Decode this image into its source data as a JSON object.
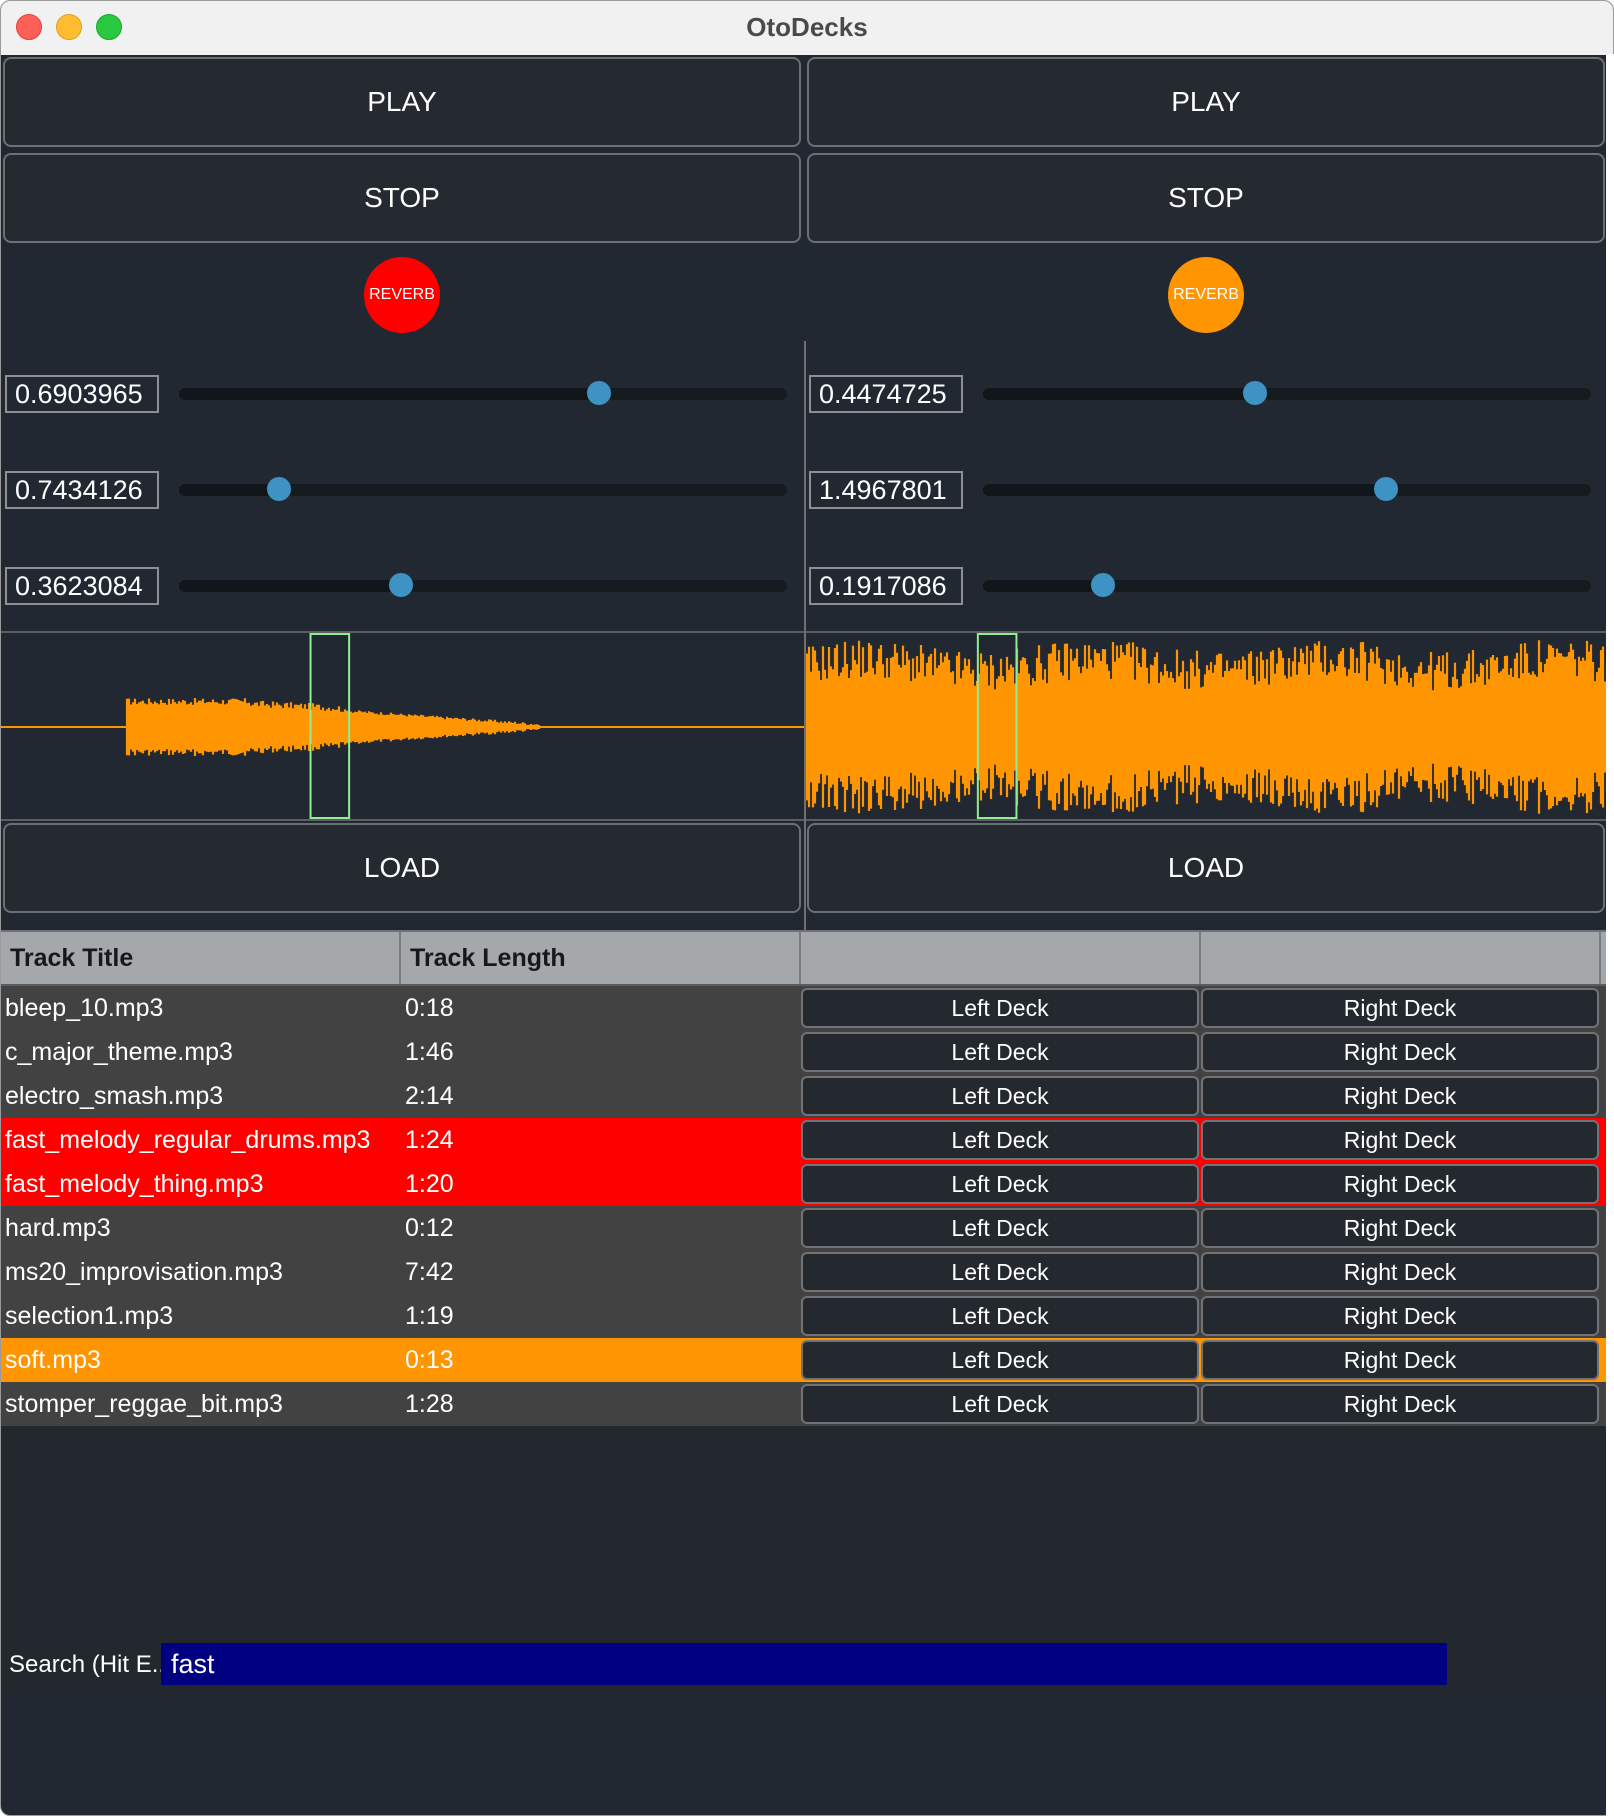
{
  "window": {
    "title": "OtoDecks"
  },
  "colors": {
    "background": "#222831",
    "waveform": "#ff9500",
    "playhead": "#90ee90",
    "reverb_left": "#ff0000",
    "reverb_right": "#ff9500",
    "match_highlight": "#ff0000",
    "loaded_highlight": "#ff9500",
    "search_bg": "#000080"
  },
  "decks": [
    {
      "id": "left",
      "play_label": "PLAY",
      "stop_label": "STOP",
      "reverb_label": "REVERB",
      "load_label": "LOAD",
      "sliders": [
        {
          "value": "0.6903965",
          "fraction": 0.69
        },
        {
          "value": "0.7434126",
          "fraction": 0.165
        },
        {
          "value": "0.3623084",
          "fraction": 0.365
        }
      ],
      "playhead_fraction": 0.385,
      "playhead_width_fraction": 0.048
    },
    {
      "id": "right",
      "play_label": "PLAY",
      "stop_label": "STOP",
      "reverb_label": "REVERB",
      "load_label": "LOAD",
      "sliders": [
        {
          "value": "0.4474725",
          "fraction": 0.448
        },
        {
          "value": "1.4967801",
          "fraction": 0.663
        },
        {
          "value": "0.1917086",
          "fraction": 0.198
        }
      ],
      "playhead_fraction": 0.215,
      "playhead_width_fraction": 0.048
    }
  ],
  "playlist": {
    "columns": [
      "Track Title",
      "Track Length",
      "",
      ""
    ],
    "left_button_label": "Left Deck",
    "right_button_label": "Right Deck",
    "tracks": [
      {
        "title": "bleep_10.mp3",
        "length": "0:18",
        "highlight": "none"
      },
      {
        "title": "c_major_theme.mp3",
        "length": "1:46",
        "highlight": "none"
      },
      {
        "title": "electro_smash.mp3",
        "length": "2:14",
        "highlight": "none"
      },
      {
        "title": "fast_melody_regular_drums.mp3",
        "length": "1:24",
        "highlight": "match"
      },
      {
        "title": "fast_melody_thing.mp3",
        "length": "1:20",
        "highlight": "match"
      },
      {
        "title": "hard.mp3",
        "length": "0:12",
        "highlight": "none"
      },
      {
        "title": "ms20_improvisation.mp3",
        "length": "7:42",
        "highlight": "none"
      },
      {
        "title": "selection1.mp3",
        "length": "1:19",
        "highlight": "none"
      },
      {
        "title": "soft.mp3",
        "length": "0:13",
        "highlight": "loaded"
      },
      {
        "title": "stomper_reggae_bit.mp3",
        "length": "1:28",
        "highlight": "none"
      }
    ]
  },
  "search": {
    "label": "Search (Hit E...",
    "value": "fast"
  }
}
